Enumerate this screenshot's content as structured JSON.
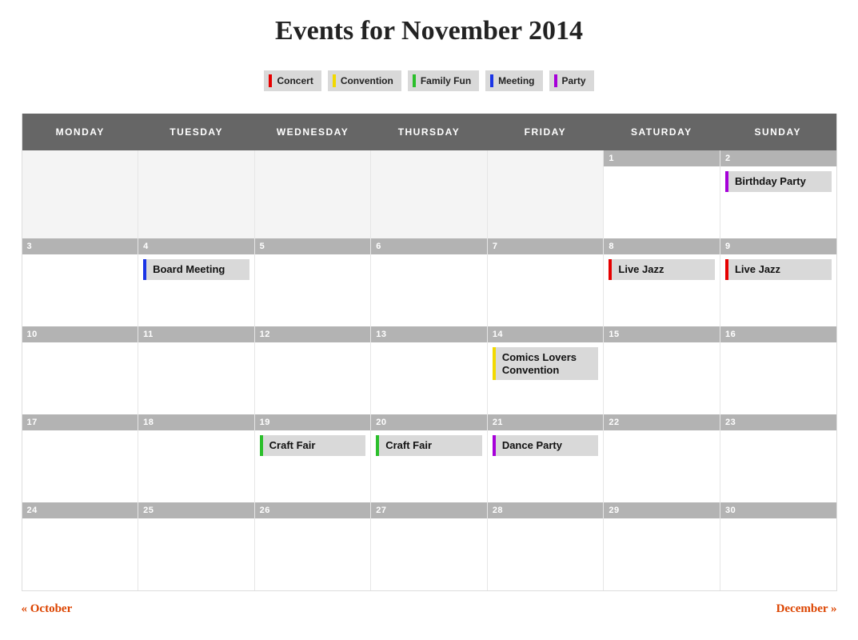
{
  "title": "Events for November 2014",
  "categories": [
    {
      "id": "concert",
      "label": "Concert",
      "color": "#e60000"
    },
    {
      "id": "convention",
      "label": "Convention",
      "color": "#f2d900"
    },
    {
      "id": "familyfun",
      "label": "Family Fun",
      "color": "#2bbf2b"
    },
    {
      "id": "meeting",
      "label": "Meeting",
      "color": "#1a34e6"
    },
    {
      "id": "party",
      "label": "Party",
      "color": "#a600d9"
    }
  ],
  "weekdays": [
    "MONDAY",
    "TUESDAY",
    "WEDNESDAY",
    "THURSDAY",
    "FRIDAY",
    "SATURDAY",
    "SUNDAY"
  ],
  "month_start_weekday": 5,
  "days_in_month": 30,
  "events": [
    {
      "day": 2,
      "title": "Birthday Party",
      "category": "party"
    },
    {
      "day": 4,
      "title": "Board Meeting",
      "category": "meeting"
    },
    {
      "day": 8,
      "title": "Live Jazz",
      "category": "concert"
    },
    {
      "day": 9,
      "title": "Live Jazz",
      "category": "concert"
    },
    {
      "day": 14,
      "title": "Comics Lovers Convention",
      "category": "convention"
    },
    {
      "day": 19,
      "title": "Craft Fair",
      "category": "familyfun"
    },
    {
      "day": 20,
      "title": "Craft Fair",
      "category": "familyfun"
    },
    {
      "day": 21,
      "title": "Dance Party",
      "category": "party"
    }
  ],
  "nav": {
    "prev": "« October",
    "next": "December »"
  }
}
